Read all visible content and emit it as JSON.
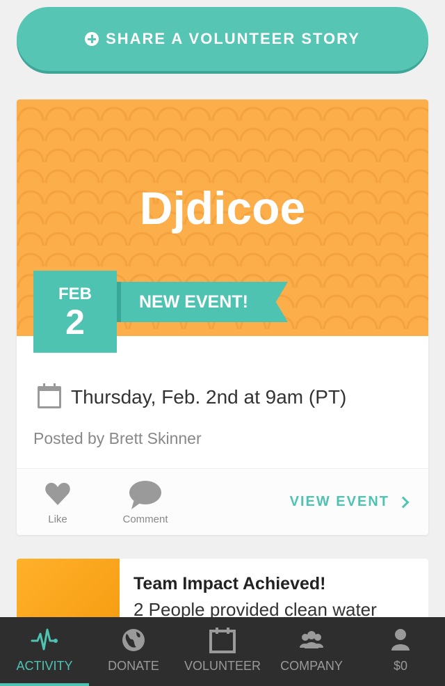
{
  "share_button": {
    "label": "SHARE A VOLUNTEER STORY",
    "icon": "plus-circle-icon"
  },
  "event_card": {
    "title": "Djdicoe",
    "date_month": "FEB",
    "date_day": "2",
    "badge": "NEW EVENT!",
    "when": "Thursday, Feb. 2nd at 9am (PT)",
    "posted_by": "Posted by Brett Skinner",
    "like_label": "Like",
    "comment_label": "Comment",
    "view_label": "VIEW EVENT",
    "colors": {
      "banner": "#fbae4a",
      "accent": "#4fc3b2"
    }
  },
  "impact_card": {
    "title": "Team Impact Achieved!",
    "text": "2 People provided clean water"
  },
  "tabbar": {
    "items": [
      {
        "label": "ACTIVITY",
        "icon": "pulse-icon",
        "active": true
      },
      {
        "label": "DONATE",
        "icon": "globe-icon",
        "active": false
      },
      {
        "label": "VOLUNTEER",
        "icon": "calendar-icon",
        "active": false
      },
      {
        "label": "COMPANY",
        "icon": "group-icon",
        "active": false
      },
      {
        "label": "$0",
        "icon": "person-icon",
        "active": false
      }
    ]
  }
}
